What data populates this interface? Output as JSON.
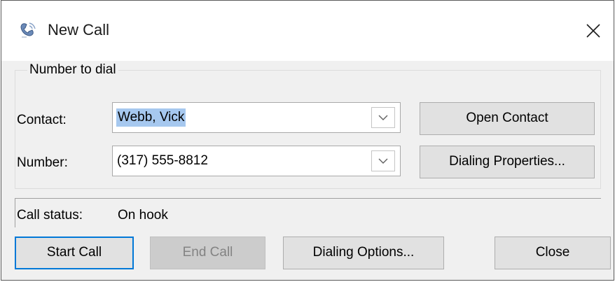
{
  "window": {
    "title": "New Call",
    "icon": "phone-call-icon",
    "close_icon": "close-icon"
  },
  "number_group": {
    "legend": "Number to dial",
    "contact_label": "Contact:",
    "contact_value": "Webb, Vick",
    "number_label": "Number:",
    "number_value": "(317) 555-8812",
    "open_contact_button": "Open Contact",
    "dialing_properties_button": "Dialing Properties..."
  },
  "status": {
    "label": "Call status:",
    "value": "On hook"
  },
  "buttons": {
    "start_call": "Start Call",
    "end_call": "End Call",
    "dialing_options": "Dialing Options...",
    "close": "Close"
  },
  "colors": {
    "selection": "#a6c8ef",
    "default_button_border": "#0078d7",
    "dialog_background": "#f0f0f0"
  }
}
